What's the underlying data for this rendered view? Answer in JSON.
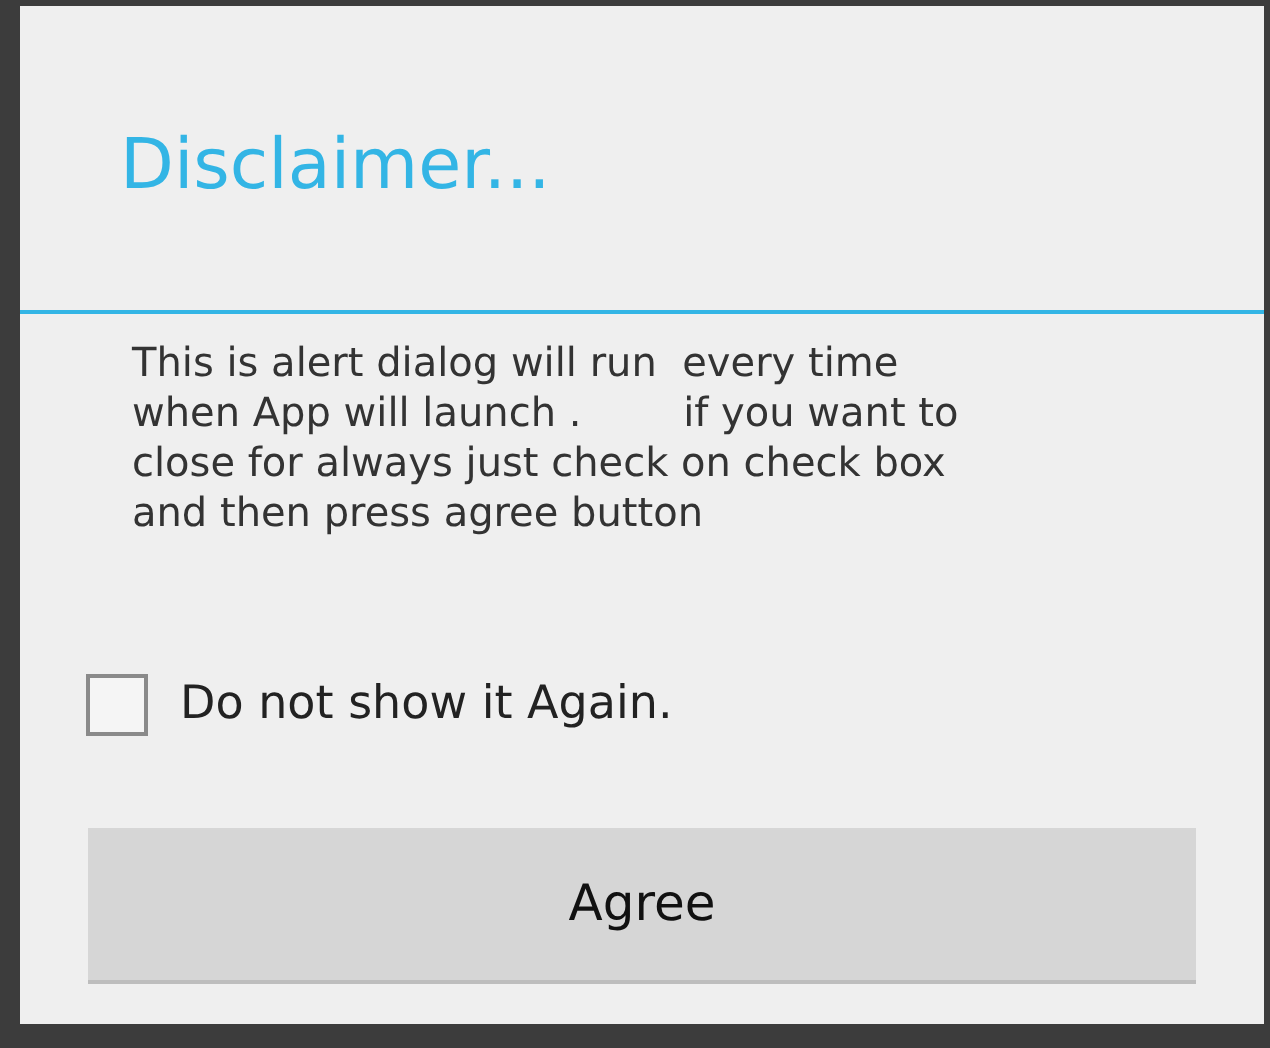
{
  "dialog": {
    "title": "Disclaimer...",
    "message": "This is alert dialog will run  every time\nwhen App will launch .        if you want to\nclose for always just check on check box\nand then press agree button",
    "checkbox": {
      "label": "Do not show it Again.",
      "checked": false
    },
    "button": "Agree"
  }
}
